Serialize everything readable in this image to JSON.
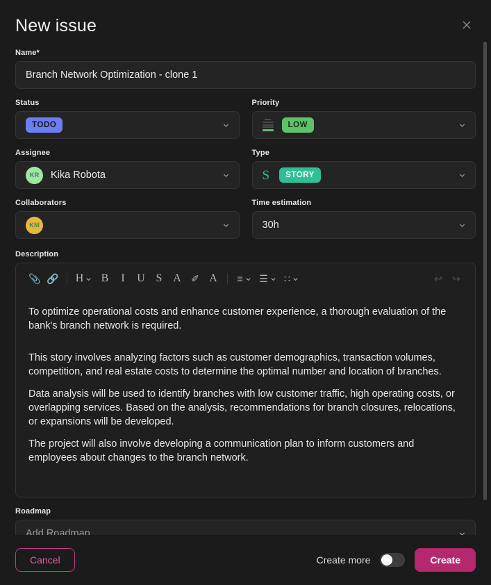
{
  "header": {
    "title": "New issue",
    "close_icon": "close-icon"
  },
  "fields": {
    "name": {
      "label": "Name*",
      "value": "Branch Network Optimization - clone 1"
    },
    "status": {
      "label": "Status",
      "badge": "TODO",
      "badge_color": "#6c7ef2"
    },
    "priority": {
      "label": "Priority",
      "badge": "LOW",
      "badge_color": "#5ec269",
      "icon": "priority-bars-icon"
    },
    "assignee": {
      "label": "Assignee",
      "value": "Kika Robota",
      "avatar_initials": "KR",
      "avatar_color": "#9ce89c"
    },
    "type": {
      "label": "Type",
      "letter": "S",
      "badge": "STORY",
      "badge_color": "#2fbf96"
    },
    "collaborators": {
      "label": "Collaborators",
      "avatar_initials": "KM",
      "avatar_color": "#e6b93c"
    },
    "time_estimation": {
      "label": "Time estimation",
      "value": "30h"
    },
    "roadmap": {
      "label": "Roadmap",
      "placeholder": "Add Roadmap"
    }
  },
  "description": {
    "label": "Description",
    "toolbar": [
      {
        "name": "attach-icon",
        "glyph": "📎",
        "caret": false,
        "disabled": false
      },
      {
        "name": "link-icon",
        "glyph": "🔗",
        "caret": false,
        "disabled": true
      },
      {
        "name": "heading-icon",
        "glyph": "H",
        "caret": true,
        "disabled": false
      },
      {
        "name": "bold-icon",
        "glyph": "B",
        "caret": false,
        "disabled": false
      },
      {
        "name": "italic-icon",
        "glyph": "I",
        "caret": false,
        "disabled": false
      },
      {
        "name": "underline-icon",
        "glyph": "U",
        "caret": false,
        "disabled": false
      },
      {
        "name": "strikethrough-icon",
        "glyph": "S",
        "caret": false,
        "disabled": false
      },
      {
        "name": "text-color-icon",
        "glyph": "A",
        "caret": false,
        "disabled": false
      },
      {
        "name": "highlighter-icon",
        "glyph": "✐",
        "caret": false,
        "disabled": false
      },
      {
        "name": "font-color-icon",
        "glyph": "A",
        "caret": false,
        "disabled": false
      },
      {
        "name": "align-icon",
        "glyph": "≡",
        "caret": true,
        "disabled": false
      },
      {
        "name": "list-icon",
        "glyph": "☰",
        "caret": true,
        "disabled": false
      },
      {
        "name": "grid-icon",
        "glyph": "∷",
        "caret": true,
        "disabled": false
      },
      {
        "name": "undo-icon",
        "glyph": "↩",
        "caret": false,
        "disabled": true
      },
      {
        "name": "redo-icon",
        "glyph": "↪",
        "caret": false,
        "disabled": true
      }
    ],
    "paragraphs": [
      "To optimize operational costs and enhance customer experience, a thorough evaluation of the bank's branch network is required.",
      "This story involves analyzing factors such as customer demographics, transaction volumes, competition, and real estate costs to determine the optimal number and location of branches.",
      "Data analysis will be used to identify branches with low customer traffic, high operating costs, or overlapping services. Based on the analysis, recommendations for branch closures, relocations, or expansions will be developed.",
      "The project will also involve developing a communication plan to inform customers and employees about changes to the branch network."
    ]
  },
  "footer": {
    "cancel_label": "Cancel",
    "create_more_label": "Create more",
    "create_more_on": false,
    "create_label": "Create",
    "accent_color": "#b5286e"
  }
}
